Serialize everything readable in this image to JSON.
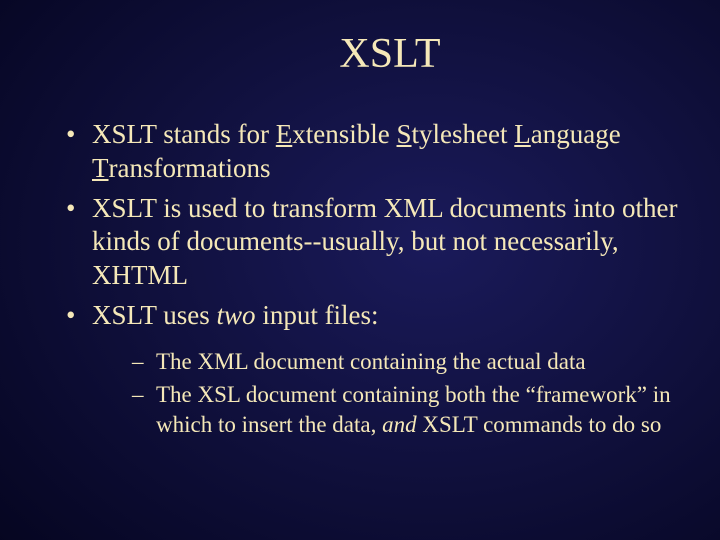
{
  "title": "XSLT",
  "bullets": [
    {
      "pre": "XSLT stands for ",
      "ux": "E",
      "uw": "xtensible",
      "mid1": " ",
      "ux2": "S",
      "uw2": "tylesheet",
      "mid2": " ",
      "ux3": "L",
      "uw3": "anguage",
      "mid3": " ",
      "ux4": "T",
      "uw4": "ransformations"
    },
    {
      "text": "XSLT is used to transform XML documents into other kinds of documents--usually, but not necessarily, XHTML"
    },
    {
      "pre": "XSLT uses ",
      "it": "two",
      "post": " input files:"
    }
  ],
  "subbullets": [
    "The XML document containing the actual data",
    {
      "pre": "The XSL document containing both the “framework” in which to insert the data, ",
      "it": "and",
      "post": " XSLT commands to do so"
    }
  ]
}
